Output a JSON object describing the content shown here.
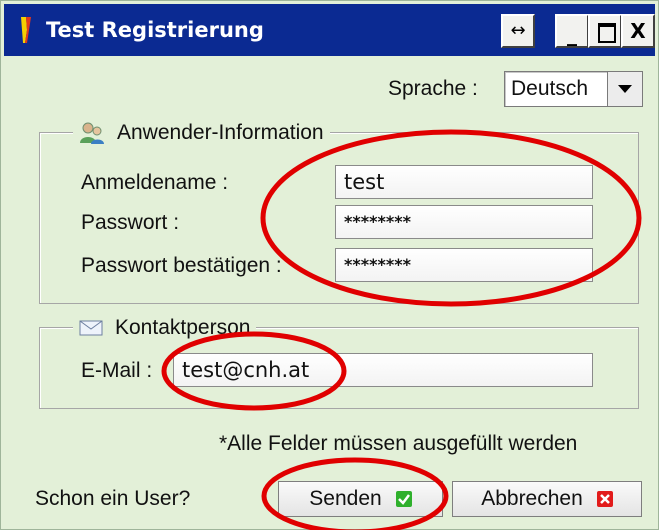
{
  "window": {
    "title": "Test Registrierung",
    "resize_glyph": "↔",
    "minimize_glyph": "_",
    "close_glyph": "X",
    "title_bar_color": "#0b2a92",
    "background_color": "#e3f0d8"
  },
  "language": {
    "label": "Sprache :",
    "selected": "Deutsch"
  },
  "user_info": {
    "legend": "Anwender-Information",
    "icon": "users-icon",
    "username_label": "Anmeldename :",
    "username_value": "test",
    "password_label": "Passwort :",
    "password_value": "********",
    "password_confirm_label": "Passwort bestätigen :",
    "password_confirm_value": "********"
  },
  "contact": {
    "legend": "Kontaktperson",
    "icon": "envelope-icon",
    "email_label": "E-Mail :",
    "email_value": "test@cnh.at"
  },
  "footer": {
    "note": "*Alle Felder müssen ausgefüllt werden",
    "existing_user_text": "Schon ein User?",
    "send_label": "Senden",
    "cancel_label": "Abbrechen",
    "send_icon": "check-icon",
    "cancel_icon": "x-icon",
    "send_icon_color": "#2fb02c",
    "cancel_icon_color": "#e21b1b"
  },
  "annotation": {
    "circle_color": "#e00000"
  }
}
